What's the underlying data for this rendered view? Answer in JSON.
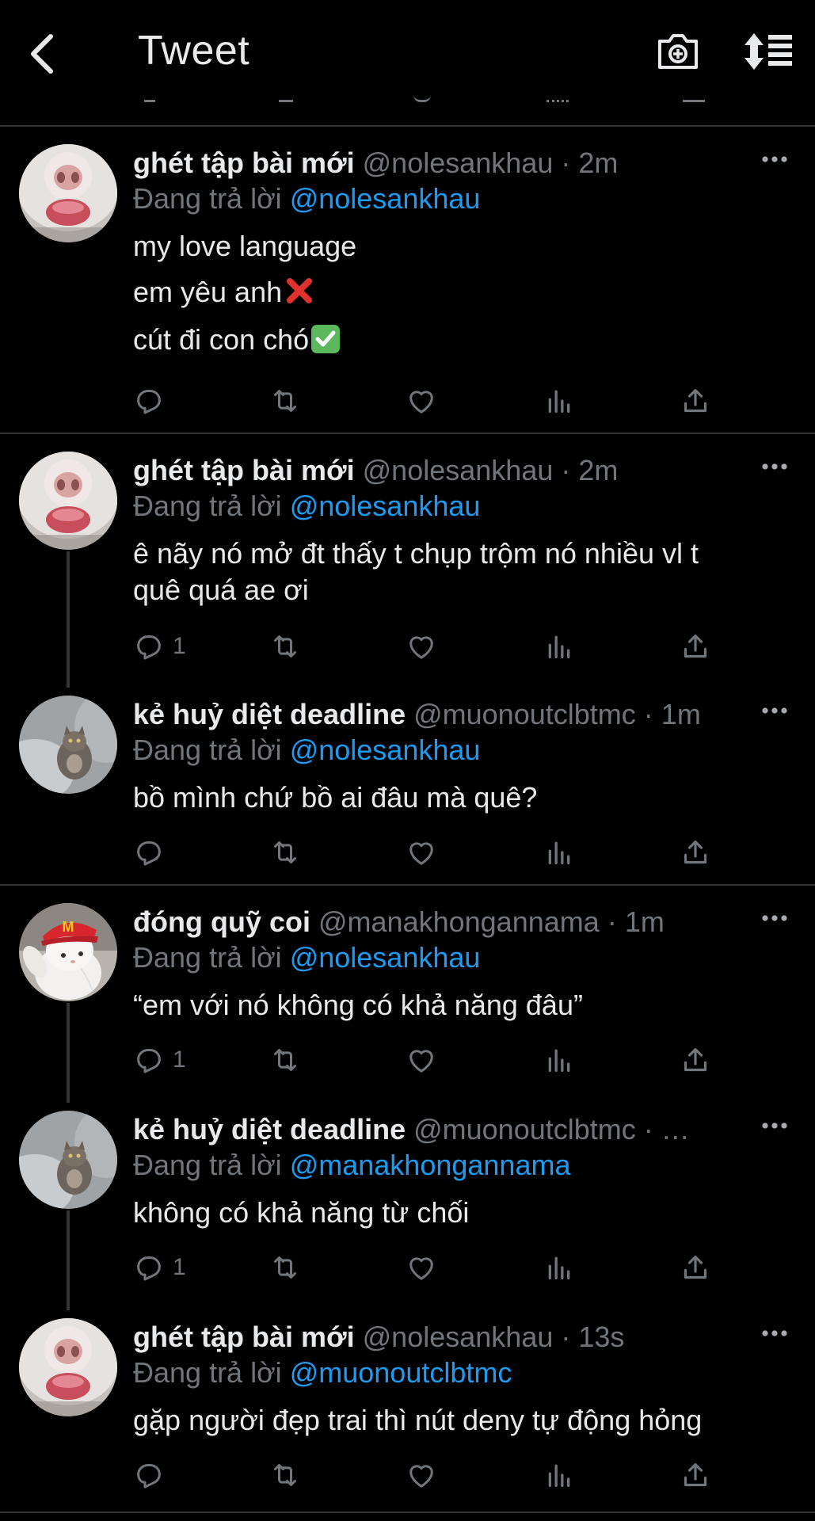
{
  "header": {
    "title": "Tweet",
    "back_icon": "chevron-left-icon",
    "camera_icon": "camera-icon",
    "sort_icon": "sort-icon"
  },
  "colors": {
    "background": "#000000",
    "primary_text": "#e7e9ea",
    "secondary_text": "#71767b",
    "mention": "#1d9bf0",
    "separator": "#2f3336"
  },
  "reply_prefix": "Đang trả lời",
  "tweets": [
    {
      "name": "ghét tập bài mới",
      "handle": "@nolesankhau",
      "dot": "·",
      "time": "2m",
      "reply_to": "@nolesankhau",
      "lines": [
        "my love language",
        "em yêu anh",
        "cút đi con chó"
      ],
      "avatar": "hamster",
      "reply_count": ""
    },
    {
      "name": "ghét tập bài mới",
      "handle": "@nolesankhau",
      "dot": "·",
      "time": "2m",
      "reply_to": "@nolesankhau",
      "lines": [
        "ê nãy nó mở đt thấy t chụp trộm nó nhiều vl t",
        "quê quá ae ơi"
      ],
      "avatar": "hamster",
      "reply_count": "1"
    },
    {
      "name": "kẻ huỷ diệt deadline",
      "handle": "@muonoutclbtmc",
      "dot": "·",
      "time": "1m",
      "reply_to": "@nolesankhau",
      "lines": [
        "bồ mình chứ bồ ai đâu mà quê?"
      ],
      "avatar": "cat",
      "reply_count": ""
    },
    {
      "name": "đóng quỹ coi",
      "handle": "@manakhongannama",
      "dot": "·",
      "time": "1m",
      "reply_to": "@nolesankhau",
      "lines": [
        "“em với nó không có khả năng đâu”"
      ],
      "avatar": "bunny",
      "reply_count": "1"
    },
    {
      "name": "kẻ huỷ diệt deadline",
      "handle": "@muonoutclbtmc",
      "dot": "·",
      "time": "…",
      "reply_to": "@manakhongannama",
      "lines": [
        "không có khả năng từ chối"
      ],
      "avatar": "cat",
      "reply_count": "1"
    },
    {
      "name": "ghét tập bài mới",
      "handle": "@nolesankhau",
      "dot": "·",
      "time": "13s",
      "reply_to": "@muonoutclbtmc",
      "lines": [
        "gặp người đẹp trai thì nút deny tự động hỏng"
      ],
      "avatar": "hamster",
      "reply_count": ""
    }
  ]
}
